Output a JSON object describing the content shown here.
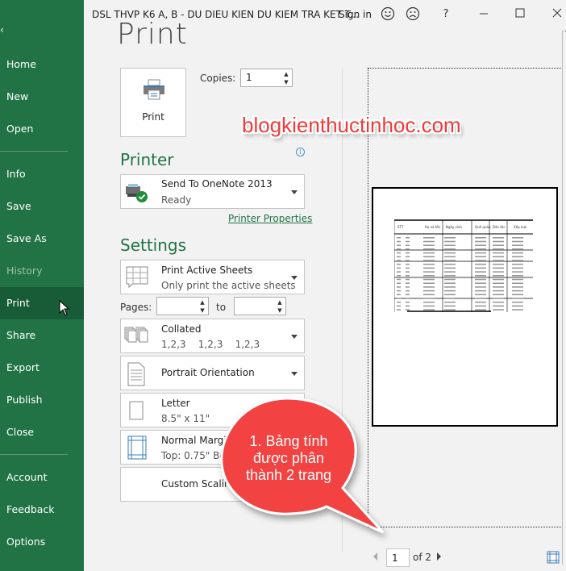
{
  "window": {
    "title": "DSL THVP K6 A, B - DU DIEU KIEN DU KIEM TRA KET T...",
    "sign_in": "Sign in",
    "icons": [
      "smile-icon",
      "frown-icon",
      "help-icon",
      "minimize-icon",
      "maximize-icon",
      "close-icon"
    ],
    "help_glyph": "?"
  },
  "sidebar": {
    "back_glyph": "‹",
    "items": [
      {
        "label": "Home",
        "state": "normal"
      },
      {
        "label": "New",
        "state": "normal"
      },
      {
        "label": "Open",
        "state": "normal"
      },
      {
        "label": "Info",
        "state": "normal"
      },
      {
        "label": "Save",
        "state": "normal"
      },
      {
        "label": "Save As",
        "state": "normal"
      },
      {
        "label": "History",
        "state": "disabled"
      },
      {
        "label": "Print",
        "state": "active"
      },
      {
        "label": "Share",
        "state": "normal"
      },
      {
        "label": "Export",
        "state": "normal"
      },
      {
        "label": "Publish",
        "state": "normal"
      },
      {
        "label": "Close",
        "state": "normal"
      },
      {
        "label": "Account",
        "state": "normal"
      },
      {
        "label": "Feedback",
        "state": "normal"
      },
      {
        "label": "Options",
        "state": "normal"
      }
    ]
  },
  "print": {
    "heading": "Print",
    "button_label": "Print",
    "copies_label": "Copies:",
    "copies_value": "1"
  },
  "printer": {
    "heading": "Printer",
    "name": "Send To OneNote 2013",
    "status": "Ready",
    "properties_link": "Printer Properties",
    "info_glyph": "i"
  },
  "settings": {
    "heading": "Settings",
    "what": {
      "title": "Print Active Sheets",
      "subtitle": "Only print the active sheets"
    },
    "pages_label": "Pages:",
    "pages_from": "",
    "to_label": "to",
    "pages_to": "",
    "collation": {
      "title": "Collated",
      "subtitle": "1,2,3    1,2,3    1,2,3"
    },
    "orientation": {
      "title": "Portrait Orientation"
    },
    "paper": {
      "title": "Letter",
      "subtitle": "8.5\" x 11\""
    },
    "margins": {
      "title": "Normal Margins",
      "subtitle": "Top: 0.75\" Bottom: 0.75\""
    },
    "scaling": {
      "title": "Custom Scaling"
    }
  },
  "preview": {
    "current_page": "1",
    "of_label": "of 2",
    "table_headers": [
      "STT",
      "Họ và tên",
      "Ngày sinh",
      "Quê quán",
      "Dân tộc",
      "Xếp loại"
    ]
  },
  "annotations": {
    "watermark": "blogkienthuctinhoc.com",
    "callout_lines": [
      "1. Bảng tính",
      "được phân",
      "thành 2 trang"
    ]
  },
  "colors": {
    "accent": "#217346",
    "sidebar_active": "#185c37",
    "callout": "#f24343"
  }
}
